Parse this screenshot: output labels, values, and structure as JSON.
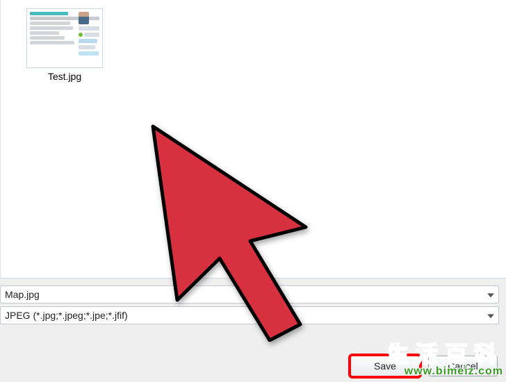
{
  "file_area": {
    "items": [
      {
        "label": "Test.jpg"
      }
    ]
  },
  "filename": {
    "value": "Map.jpg"
  },
  "filetype": {
    "value": "JPEG (*.jpg;*.jpeg;*.jpe;*.jfif)"
  },
  "buttons": {
    "save": "Save",
    "cancel": "Cancel"
  },
  "watermark": {
    "line1": "生活百科",
    "line2": "www.bimeiz.com"
  },
  "colors": {
    "highlight": "#ff0008",
    "arrow_fill": "#dc3545",
    "arrow_stroke": "#000000",
    "watermark": "#3a9b24"
  }
}
